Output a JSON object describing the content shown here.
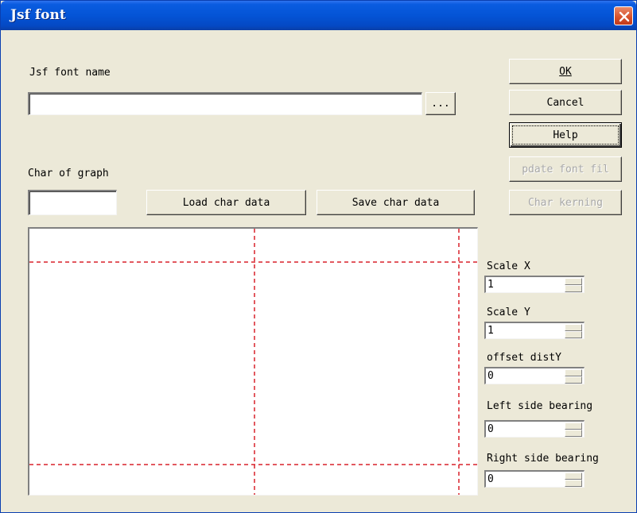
{
  "window": {
    "title": "Jsf font"
  },
  "font_name": {
    "label": "Jsf font name",
    "value": "",
    "browse_label": "..."
  },
  "buttons": {
    "ok": "OK",
    "cancel": "Cancel",
    "help": "Help",
    "update_font_file": "pdate font fil",
    "char_kerning": "Char kerning"
  },
  "char_graph": {
    "label": "Char of graph",
    "value": "",
    "load_label": "Load char data",
    "save_label": "Save char data"
  },
  "params": [
    {
      "label": "Scale X",
      "value": "1"
    },
    {
      "label": "Scale Y",
      "value": "1"
    },
    {
      "label": "offset distY",
      "value": "0"
    },
    {
      "label": "Left side bearing",
      "value": "0"
    },
    {
      "label": "Right side bearing",
      "value": "0"
    }
  ],
  "colors": {
    "guide_line": "#d8202a",
    "title_bar": "#0454d6",
    "dialog_face": "#ece9d8"
  }
}
